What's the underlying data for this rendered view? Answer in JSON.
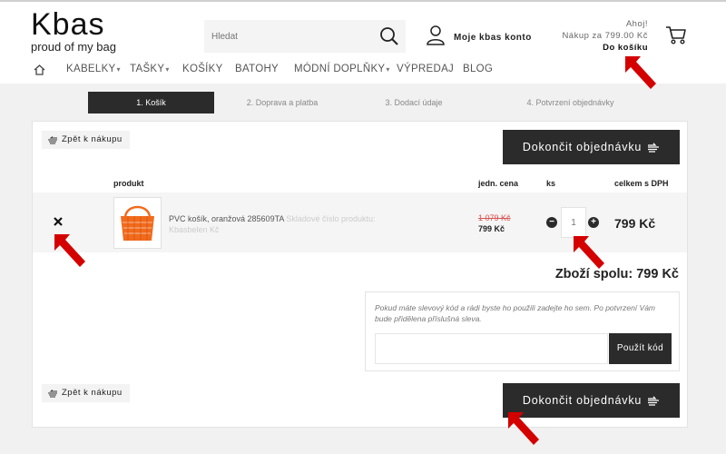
{
  "header": {
    "logo_mark": "Kbas",
    "logo_tagline": "proud of my bag",
    "search_placeholder": "Hledat",
    "account_label": "Moje kbas konto",
    "greeting": "Ahoj!",
    "cart_summary": "Nákup za 799.00 Kč",
    "cart_link": "Do košíku"
  },
  "nav": {
    "items": [
      {
        "label": "KABELKY",
        "dropdown": true
      },
      {
        "label": "TAŠKY",
        "dropdown": true
      },
      {
        "label": "KOŠÍKY",
        "dropdown": false
      },
      {
        "label": "BATOHY",
        "dropdown": false
      },
      {
        "label": "MÓDNÍ DOPLŇKY",
        "dropdown": true
      },
      {
        "label": "VÝPREDAJ",
        "dropdown": false
      },
      {
        "label": "BLOG",
        "dropdown": false
      }
    ]
  },
  "steps": [
    {
      "label": "1. Košík",
      "active": true
    },
    {
      "label": "2. Doprava a platba",
      "active": false
    },
    {
      "label": "3. Dodací údaje",
      "active": false
    },
    {
      "label": "4. Potvrzení objednávky",
      "active": false
    }
  ],
  "cart": {
    "back_label": "Zpět k nákupu",
    "finish_label": "Dokončit objednávku",
    "columns": {
      "product": "produkt",
      "unit_price": "jedn. cena",
      "qty": "ks",
      "total": "celkem s DPH"
    },
    "item": {
      "name": "PVC košík, oranžová 285609TA",
      "availability": "Skladové číslo produktu: Kbasbelen Kč",
      "old_price": "1 079 Kč",
      "unit_price": "799 Kč",
      "qty": "1",
      "total": "799 Kč"
    },
    "subtotal": "Zboží spolu: 799 Kč",
    "coupon_note": "Pokud máte slevový kód a rádi byste ho použili zadejte ho sem. Po potvrzení Vám bude přidělena příslušná sleva.",
    "coupon_button": "Použít kód"
  },
  "colors": {
    "dark": "#2b2b2b",
    "arrow_red": "#d40000",
    "old_price_red": "#d9534f",
    "product_orange": "#f26a1b"
  }
}
